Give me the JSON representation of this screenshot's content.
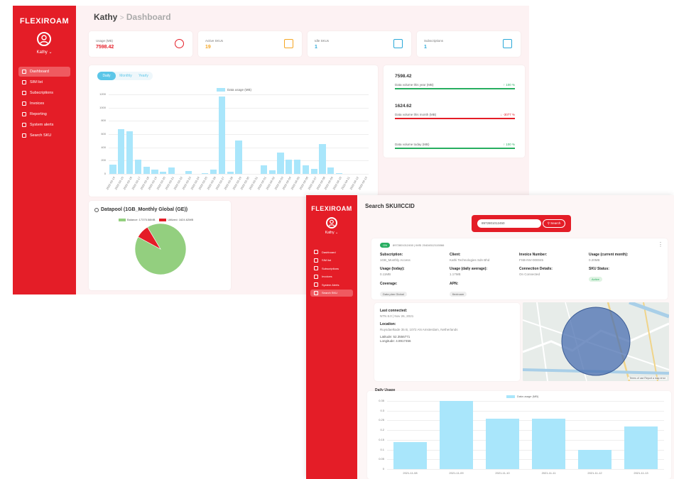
{
  "window1": {
    "brand": "FLEXIROAM",
    "user": "Kathy",
    "breadcrumb": {
      "root": "Kathy",
      "sep": ">",
      "page": "Dashboard"
    },
    "nav": [
      {
        "label": "Dashboard",
        "icon": "dashboard-icon",
        "active": true
      },
      {
        "label": "SIM list",
        "icon": "sim-icon"
      },
      {
        "label": "Subscriptions",
        "icon": "subscriptions-icon"
      },
      {
        "label": "Invoices",
        "icon": "invoice-icon"
      },
      {
        "label": "Reporting",
        "icon": "reporting-icon"
      },
      {
        "label": "System alerts",
        "icon": "bell-icon"
      },
      {
        "label": "Search SKU",
        "icon": "search-icon"
      }
    ],
    "stats": [
      {
        "label": "Usage (MB)",
        "value": "7598.42",
        "color": "#e41d27",
        "icon": "pie-chart-icon"
      },
      {
        "label": "Active SKUs",
        "value": "19",
        "color": "#f5a623",
        "icon": "sim-card-icon"
      },
      {
        "label": "Idle SKUs",
        "value": "1",
        "color": "#2aa8d8",
        "icon": "sim-card-icon"
      },
      {
        "label": "Subscriptions",
        "value": "1",
        "color": "#2aa8d8",
        "icon": "cash-icon"
      }
    ],
    "period_tabs": [
      "Daily",
      "Monthly",
      "Yearly"
    ],
    "volumes": [
      {
        "value": "7598.42",
        "label": "Data volume this year (MB)",
        "change": "↑ 100 %",
        "color": "#27ae60"
      },
      {
        "value": "1624.62",
        "label": "Data volume this month (MB)",
        "change": "↓ -3077 %",
        "color": "#e41d27"
      },
      {
        "value": "",
        "label": "Data volume today (MB)",
        "change": "↑ 100 %",
        "color": "#27ae60"
      }
    ],
    "datapool": {
      "title": "Datapool (1GB_Monthly Global (GE))",
      "legend_balance": "Balance: 17375.58MB",
      "legend_utilized": "Utilized: 1624.62MB"
    }
  },
  "window2": {
    "brand": "FLEXIROAM",
    "user": "Kathy",
    "title": "Search SKU/ICCID",
    "search_value": "8972801012450",
    "search_button": "Search",
    "nav": [
      {
        "label": "Dashboard",
        "icon": "dashboard-icon"
      },
      {
        "label": "SIM list",
        "icon": "sim-icon"
      },
      {
        "label": "Subscriptions",
        "icon": "subscriptions-icon"
      },
      {
        "label": "Invoices",
        "icon": "invoice-icon"
      },
      {
        "label": "System Alerts",
        "icon": "bell-icon"
      },
      {
        "label": "Search SKU",
        "icon": "search-icon",
        "active": true
      }
    ],
    "status_badge": "ON",
    "iccid_line": "8972801012450 | IMSI 20404512115066",
    "details": [
      {
        "label": "Subscription:",
        "value": "1GB_Monthly Access"
      },
      {
        "label": "Client:",
        "value": "Kathi Technologies Sdn Bhd"
      },
      {
        "label": "Invoice Number:",
        "value": "FSB-INV-000045"
      },
      {
        "label": "Usage (current month):",
        "value": "0.20MB"
      },
      {
        "label": "Usage (today):",
        "value": "0.11MB"
      },
      {
        "label": "Usage (daily average):",
        "value": "1.17MB"
      },
      {
        "label": "Connection Details:",
        "value": "On Connected"
      },
      {
        "label": "SKU Status:",
        "value": "Active"
      },
      {
        "label": "Coverage:",
        "value": "Data plan Global"
      },
      {
        "label": "APN:",
        "value": "flexiroam"
      }
    ],
    "last_connected": {
      "label": "Last connected:",
      "value": "NTN 8.0 | Nov 26, 2021",
      "location_label": "Location:",
      "location": "Ruysdaelkade 35 B, 1072 AN Amsterdam, Netherlands",
      "latitude": "Latitude: 52.3556771",
      "longitude": "Longitude: 4.8917456"
    },
    "map_footer": "Terms of use   Report a map error",
    "daily_usage_title": "Daily Usage",
    "daily_legend": "Data usage (MB)"
  },
  "chart_data": [
    {
      "type": "bar",
      "series": [
        {
          "name": "Data usage (MB)",
          "values": [
            140,
            670,
            645,
            215,
            105,
            60,
            35,
            100,
            0,
            40,
            0,
            10,
            65,
            1165,
            35,
            505,
            0,
            0,
            125,
            55,
            325,
            210,
            215,
            125,
            70,
            445,
            100,
            10,
            0,
            0,
            0
          ]
        }
      ],
      "categories": [
        "2022-03-14",
        "2022-03-15",
        "2022-03-16",
        "2022-03-17",
        "2022-03-18",
        "2022-03-19",
        "2022-03-20",
        "2022-03-21",
        "2022-03-22",
        "2022-03-23",
        "2022-03-24",
        "2022-03-25",
        "2022-03-26",
        "2022-03-27",
        "2022-03-28",
        "2022-03-29",
        "2022-03-30",
        "2022-03-31",
        "2022-04-01",
        "2022-04-02",
        "2022-04-03",
        "2022-04-04",
        "2022-04-05",
        "2022-04-06",
        "2022-04-07",
        "2022-04-08",
        "2022-04-09",
        "2022-04-10",
        "2022-04-11",
        "2022-04-12",
        "2022-04-13"
      ],
      "yticks": [
        0,
        200,
        400,
        600,
        800,
        1000,
        1200
      ],
      "ylim": [
        0,
        1200
      ]
    },
    {
      "type": "pie",
      "labels": [
        "Balance",
        "Utilized"
      ],
      "values": [
        17375.58,
        1624.62
      ],
      "colors": [
        "#93cf7f",
        "#e41d27"
      ]
    },
    {
      "type": "bar",
      "series": [
        {
          "name": "Data usage (MB)",
          "values": [
            0.14,
            0.35,
            0.26,
            0.26,
            0.1,
            0.22
          ]
        }
      ],
      "categories": [
        "2021-11-08",
        "2021-11-09",
        "2021-11-10",
        "2021-11-11",
        "2021-11-12",
        "2021-11-13"
      ],
      "yticks": [
        0,
        0.05,
        0.1,
        0.15,
        0.2,
        0.25,
        0.3,
        0.35
      ],
      "ylim": [
        0,
        0.35
      ]
    }
  ]
}
